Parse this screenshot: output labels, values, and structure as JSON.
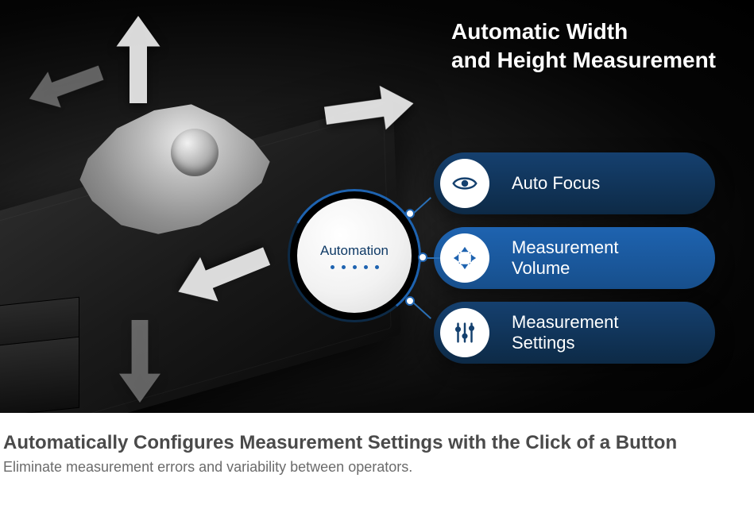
{
  "heading": {
    "line1": "Automatic Width",
    "line2": "and Height Measurement"
  },
  "hub": {
    "label": "Automation",
    "dot_count": 5
  },
  "features": [
    {
      "icon": "eye",
      "label": "Auto Focus",
      "variant": "dark"
    },
    {
      "icon": "expand",
      "label": "Measurement\nVolume",
      "variant": "light"
    },
    {
      "icon": "sliders",
      "label": "Measurement\nSettings",
      "variant": "dark"
    }
  ],
  "caption": {
    "title": "Automatically Configures Measurement Settings with the Click of a Button",
    "subtitle": "Eliminate measurement errors and variability between operators."
  },
  "colors": {
    "accent_blue": "#1e63b0",
    "dark_blue": "#0d2a46"
  }
}
